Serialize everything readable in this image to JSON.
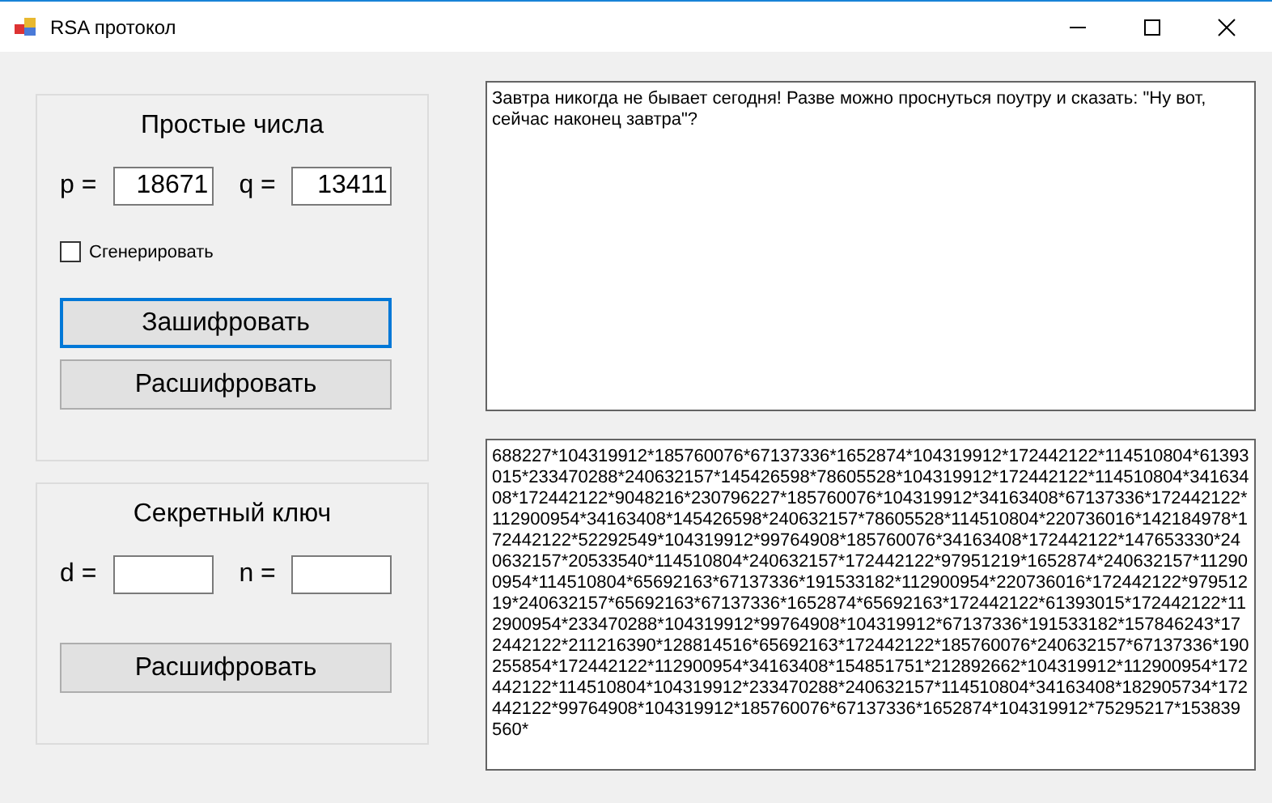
{
  "window": {
    "title": "RSA протокол"
  },
  "primes": {
    "title": "Простые числа",
    "p_label": "p =",
    "p_value": "18671",
    "q_label": "q =",
    "q_value": "13411",
    "generate": {
      "label": "Сгенерировать",
      "checked": false
    },
    "buttons": [
      {
        "label": "Зашифровать",
        "focused": true
      },
      {
        "label": "Расшифровать",
        "focused": false
      }
    ]
  },
  "secret_key": {
    "title": "Секретный ключ",
    "d_label": "d =",
    "n_label": "n =",
    "buttons": [
      {
        "label": "Расшифровать",
        "focused": false
      }
    ]
  },
  "plaintext": "Завтра никогда не бывает сегодня! Разве можно проснуться поутру и сказать: \"Ну вот, сейчас наконец завтра\"?",
  "ciphertext": "688227*104319912*185760076*67137336*1652874*104319912*172442122*114510804*61393015*233470288*240632157*145426598*78605528*104319912*172442122*114510804*34163408*172442122*9048216*230796227*185760076*104319912*34163408*67137336*172442122*112900954*34163408*145426598*240632157*78605528*114510804*220736016*142184978*172442122*52292549*104319912*99764908*185760076*34163408*172442122*147653330*240632157*20533540*114510804*240632157*172442122*97951219*1652874*240632157*112900954*114510804*65692163*67137336*191533182*112900954*220736016*172442122*97951219*240632157*65692163*67137336*1652874*65692163*172442122*61393015*172442122*112900954*233470288*104319912*99764908*104319912*67137336*191533182*157846243*172442122*211216390*128814516*65692163*172442122*185760076*240632157*67137336*190255854*172442122*112900954*34163408*154851751*212892662*104319912*112900954*172442122*114510804*104319912*233470288*240632157*114510804*34163408*182905734*172442122*99764908*104319912*185760076*67137336*1652874*104319912*75295217*153839560*"
}
